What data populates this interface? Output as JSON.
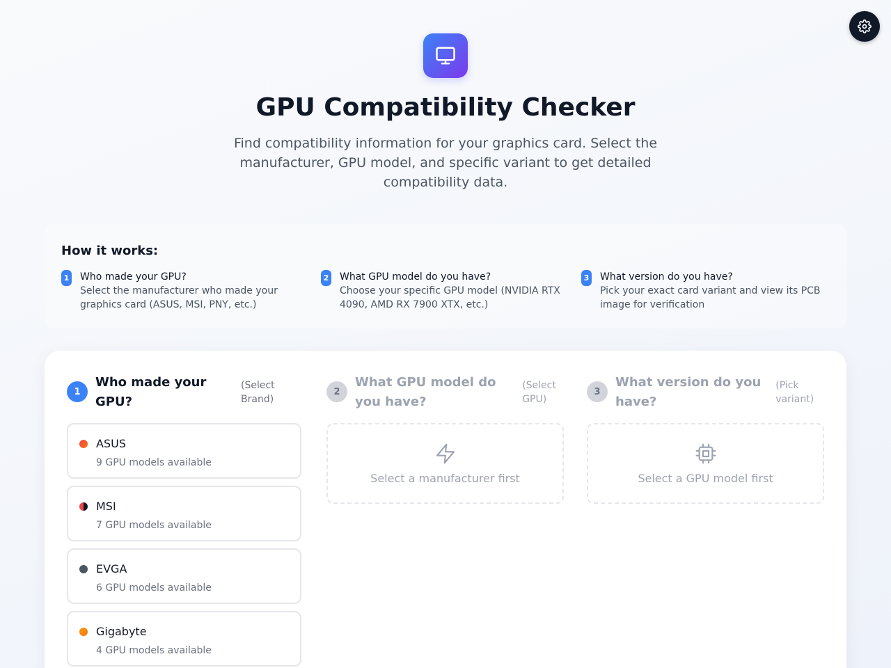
{
  "header": {
    "title": "GPU Compatibility Checker",
    "subtitle": "Find compatibility information for your graphics card. Select the manufacturer, GPU model, and specific variant to get detailed compatibility data.",
    "logo_icon": "monitor-icon",
    "settings_icon": "gear-icon"
  },
  "how_it_works": {
    "title": "How it works:",
    "steps": [
      {
        "number": "1",
        "title": "Who made your GPU?",
        "description": "Select the manufacturer who made your graphics card (ASUS, MSI, PNY, etc.)"
      },
      {
        "number": "2",
        "title": "What GPU model do you have?",
        "description": "Choose your specific GPU model (NVIDIA RTX 4090, AMD RX 7900 XTX, etc.)"
      },
      {
        "number": "3",
        "title": "What version do you have?",
        "description": "Pick your exact card variant and view its PCB image for verification"
      }
    ]
  },
  "selector": {
    "columns": [
      {
        "number": "1",
        "title": "Who made your GPU?",
        "hint": "(Select Brand)",
        "active": true
      },
      {
        "number": "2",
        "title": "What GPU model do you have?",
        "hint": "(Select GPU)",
        "active": false,
        "placeholder": "Select a manufacturer first",
        "placeholder_icon": "lightning-icon"
      },
      {
        "number": "3",
        "title": "What version do you have?",
        "hint": "(Pick variant)",
        "active": false,
        "placeholder": "Select a GPU model first",
        "placeholder_icon": "chip-icon"
      }
    ],
    "brands": [
      {
        "name": "ASUS",
        "count": "9 GPU models available",
        "color": "#ef4444",
        "color2": "#f97316"
      },
      {
        "name": "MSI",
        "count": "7 GPU models available",
        "color": "#111827",
        "color2": "#ef4444"
      },
      {
        "name": "EVGA",
        "count": "6 GPU models available",
        "color": "#4b5563",
        "color2": "#4b5563"
      },
      {
        "name": "Gigabyte",
        "count": "4 GPU models available",
        "color": "#f59e0b",
        "color2": "#f97316"
      }
    ]
  },
  "colors": {
    "accent": "#3b82f6",
    "logo_gradient_start": "#3b82f6",
    "logo_gradient_end": "#7c3aed"
  }
}
